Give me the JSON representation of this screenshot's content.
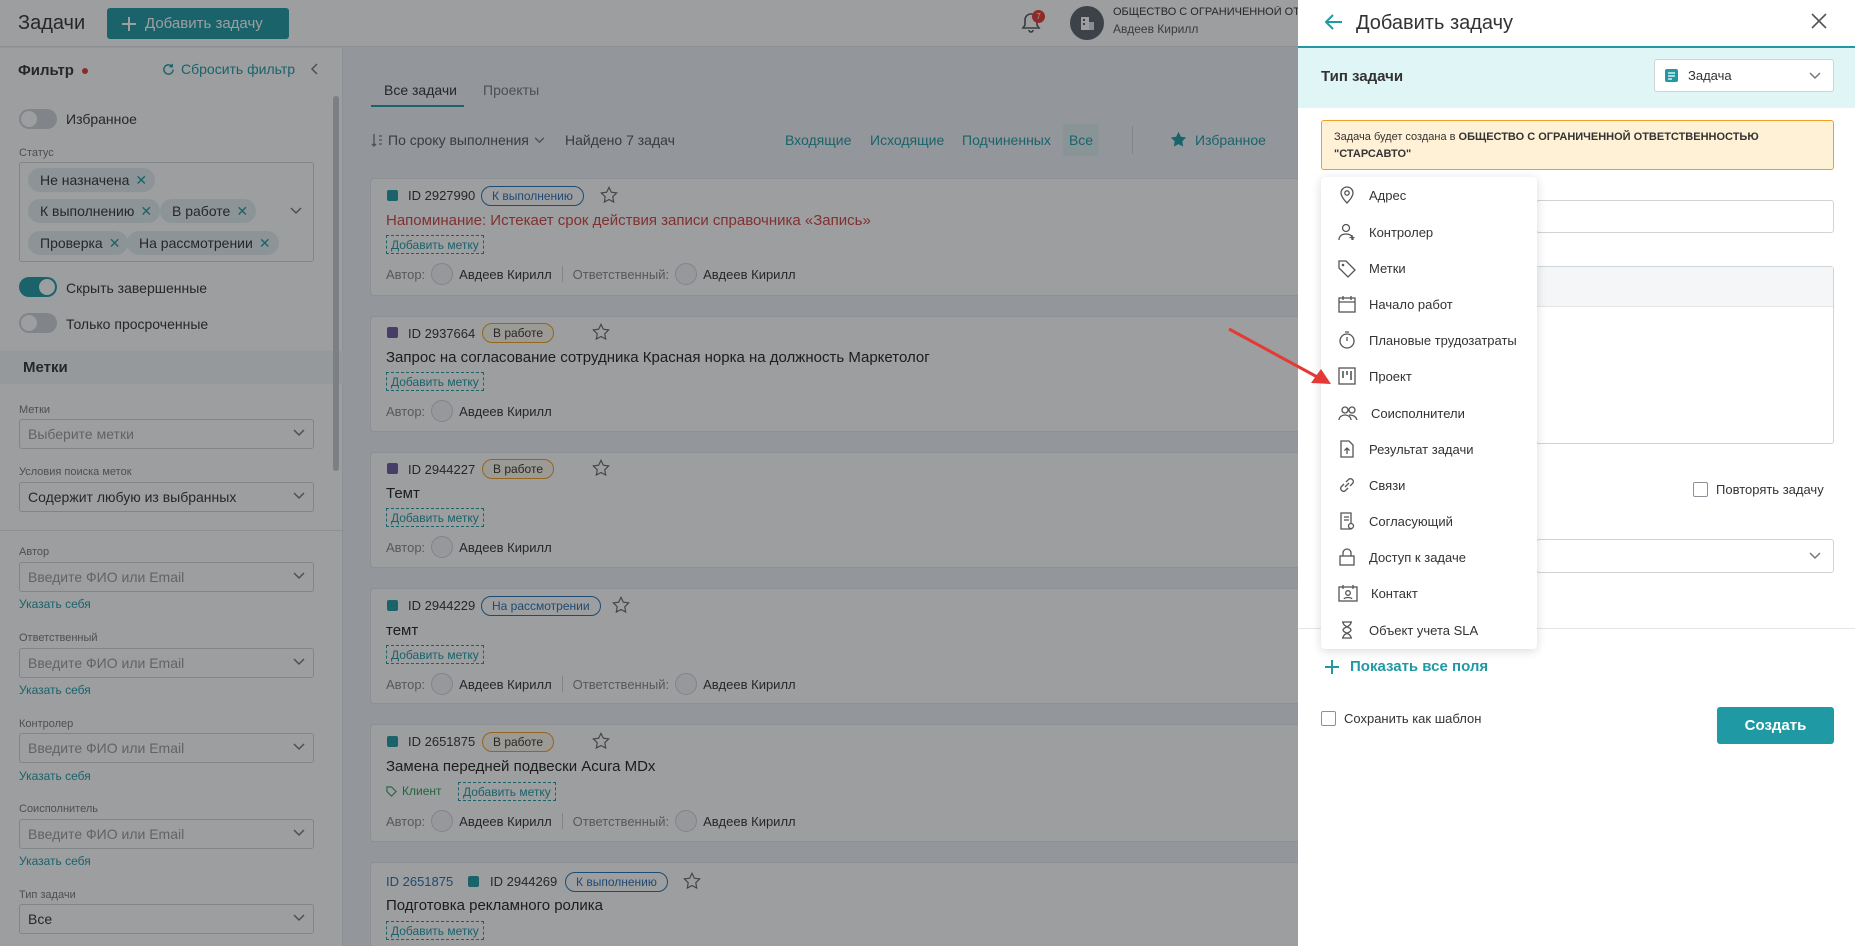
{
  "header": {
    "title": "Задачи",
    "add_button": "Добавить задачу",
    "notifications_count": "7",
    "org_name": "ОБЩЕСТВО С ОГРАНИЧЕННОЙ ОТВ",
    "user_name": "Авдеев Кирилл"
  },
  "filter": {
    "title": "Фильтр",
    "reset": "Сбросить фильтр",
    "favorites": "Избранное",
    "status_label": "Статус",
    "status_chips": [
      "Не назначена",
      "К выполнению",
      "В работе",
      "Проверка",
      "На рассмотрении"
    ],
    "hide_done": "Скрыть завершенные",
    "only_overdue": "Только просроченные",
    "tags_section": "Метки",
    "tags_label": "Метки",
    "tags_placeholder": "Выберите метки",
    "tags_cond_label": "Условия поиска меток",
    "tags_cond_value": "Содержит любую из выбранных",
    "author_label": "Автор",
    "responsible_label": "Ответственный",
    "controller_label": "Контролер",
    "coexec_label": "Соисполнитель",
    "person_placeholder": "Введите ФИО или Email",
    "me_link": "Указать себя",
    "task_type_label": "Тип задачи",
    "task_type_value": "Все"
  },
  "main": {
    "tabs": [
      "Все задачи",
      "Проекты"
    ],
    "sort": "По сроку выполнения",
    "found": "Найдено 7 задач",
    "segments": [
      "Входящие",
      "Исходящие",
      "Подчиненных",
      "Все"
    ],
    "favorites": "Избранное",
    "author_prefix": "Автор:",
    "responsible_prefix": "Ответственный:",
    "add_tag": "Добавить метку",
    "tasks": [
      {
        "id": "ID 2927990",
        "status": "К выполнению",
        "title": "Напоминание: Истекает срок действия записи справочника «Запись»",
        "author": "Авдеев Кирилл",
        "responsible": "Авдеев Кирилл"
      },
      {
        "id": "ID 2937664",
        "status": "В работе",
        "title": "Запрос на согласование сотрудника Красная норка на должность Маркетолог",
        "author": "Авдеев Кирилл"
      },
      {
        "id": "ID 2944227",
        "status": "В работе",
        "title": "Темт",
        "author": "Авдеев Кирилл"
      },
      {
        "id": "ID 2944229",
        "status": "На рассмотрении",
        "title": "темт",
        "author": "Авдеев Кирилл",
        "responsible": "Авдеев Кирилл"
      },
      {
        "id": "ID 2651875",
        "status": "В работе",
        "title": "Замена передней подвески Acura MDx",
        "client": "Клиент",
        "author": "Авдеев Кирилл",
        "responsible": "Авдеев Кирилл"
      },
      {
        "parent_id": "ID 2651875",
        "id": "ID 2944269",
        "status": "К выполнению",
        "title": "Подготовка рекламного ролика"
      }
    ]
  },
  "panel": {
    "title": "Добавить задачу",
    "type_label": "Тип задачи",
    "type_value": "Задача",
    "notice_prefix": "Задача будет создана в ",
    "notice_org": "ОБЩЕСТВО С ОГРАНИЧЕННОЙ ОТВЕТСТВЕННОСТЬЮ \"СТАРСАВТО\"",
    "repeat": "Повторять задачу",
    "show_all": "Показать все поля",
    "save_template": "Сохранить как шаблон",
    "create": "Создать",
    "menu": [
      {
        "label": "Адрес",
        "icon": "location-pin-icon"
      },
      {
        "label": "Контролер",
        "icon": "user-plus-icon"
      },
      {
        "label": "Метки",
        "icon": "tag-icon"
      },
      {
        "label": "Начало работ",
        "icon": "calendar-icon"
      },
      {
        "label": "Плановые трудозатраты",
        "icon": "stopwatch-icon"
      },
      {
        "label": "Проект",
        "icon": "kanban-icon"
      },
      {
        "label": "Соисполнители",
        "icon": "users-icon"
      },
      {
        "label": "Результат задачи",
        "icon": "document-upload-icon"
      },
      {
        "label": "Связи",
        "icon": "link-icon"
      },
      {
        "label": "Согласующий",
        "icon": "approval-icon"
      },
      {
        "label": "Доступ к задаче",
        "icon": "lock-icon"
      },
      {
        "label": "Контакт",
        "icon": "contact-card-icon"
      },
      {
        "label": "Объект учета SLA",
        "icon": "hourglass-icon"
      }
    ]
  },
  "colors": {
    "accent": "#1f9aa4",
    "danger": "#e53935",
    "warning": "#f0a020",
    "annotation_arrow": "#e53935"
  }
}
